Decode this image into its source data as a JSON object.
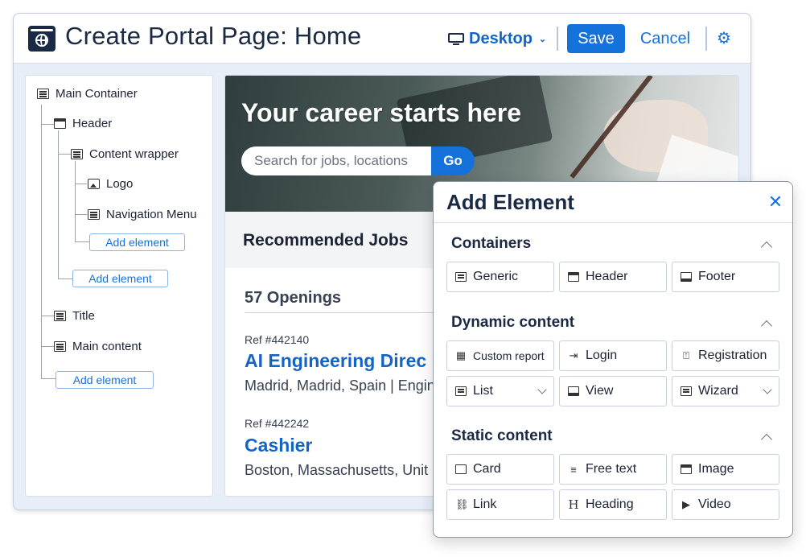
{
  "header": {
    "title": "Create Portal Page: Home",
    "device": "Desktop",
    "save_label": "Save",
    "cancel_label": "Cancel"
  },
  "tree": {
    "main_container": "Main Container",
    "header": "Header",
    "content_wrapper": "Content wrapper",
    "logo": "Logo",
    "navigation_menu": "Navigation Menu",
    "add_element": "Add element",
    "title": "Title",
    "main_content": "Main content"
  },
  "preview": {
    "hero_title": "Your career starts here",
    "search_placeholder": "Search for jobs, locations",
    "go_label": "Go",
    "recommended": "Recommended Jobs",
    "openings": "57 Openings",
    "jobs": [
      {
        "ref": "Ref #442140",
        "title": "AI Engineering Direc",
        "location": "Madrid, Madrid, Spain | Engin"
      },
      {
        "ref": "Ref #442242",
        "title": "Cashier",
        "location": "Boston, Massachusetts, Unit"
      }
    ]
  },
  "modal": {
    "title": "Add Element",
    "sections": {
      "containers": {
        "title": "Containers",
        "items": [
          "Generic",
          "Header",
          "Footer"
        ]
      },
      "dynamic": {
        "title": "Dynamic content",
        "items": [
          "Custom report",
          "Login",
          "Registration",
          "List",
          "View",
          "Wizard"
        ]
      },
      "static": {
        "title": "Static content",
        "items": [
          "Card",
          "Free text",
          "Image",
          "Link",
          "Heading",
          "Video"
        ]
      }
    }
  },
  "colors": {
    "accent": "#1672db",
    "title_text": "#1b2a44",
    "panel_bg": "#e8eef8"
  },
  "icons": [
    "globe-icon",
    "monitor-icon",
    "chevron-down-icon",
    "gear-icon",
    "container-icon",
    "header-icon",
    "image-icon",
    "close-icon",
    "chevron-up-icon"
  ]
}
